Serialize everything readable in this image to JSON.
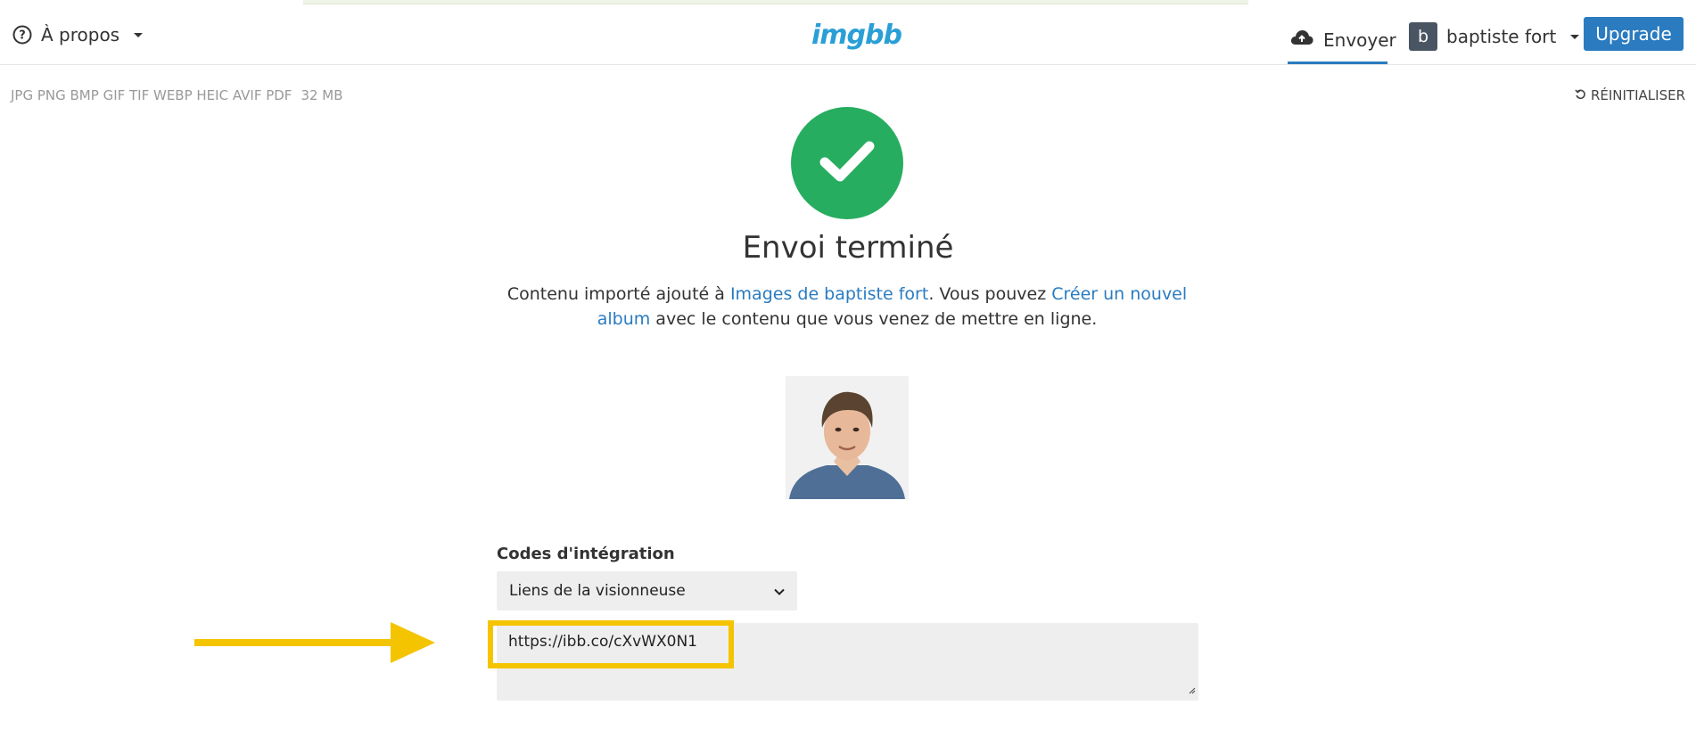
{
  "header": {
    "about_label": "À propos",
    "logo": "imgbb",
    "upload_label": "Envoyer",
    "user_initial": "b",
    "user_name": "baptiste fort",
    "upgrade_label": "Upgrade"
  },
  "toolbar": {
    "formats": "JPG PNG BMP GIF TIF WEBP HEIC AVIF PDF",
    "max_size": "32 MB",
    "reset_label": "RÉINITIALISER"
  },
  "result": {
    "title": "Envoi terminé",
    "desc_part1": "Contenu importé ajouté à ",
    "desc_link1": "Images de baptiste fort",
    "desc_part2": ". Vous pouvez ",
    "desc_link2": "Créer un nouvel album",
    "desc_part3": " avec le contenu que vous venez de mettre en ligne."
  },
  "embed": {
    "label": "Codes d'intégration",
    "selected_option": "Liens de la visionneuse",
    "code": "https://ibb.co/cXvWX0N1"
  },
  "colors": {
    "accent": "#2a7bc0",
    "success": "#27ad60",
    "highlight": "#f5c400",
    "logo": "#2a9fd6"
  },
  "icons": [
    "help-circle-icon",
    "caret-down-icon",
    "cloud-upload-icon",
    "reset-icon",
    "checkmark-icon",
    "chevron-down-icon",
    "arrow-right-icon"
  ]
}
